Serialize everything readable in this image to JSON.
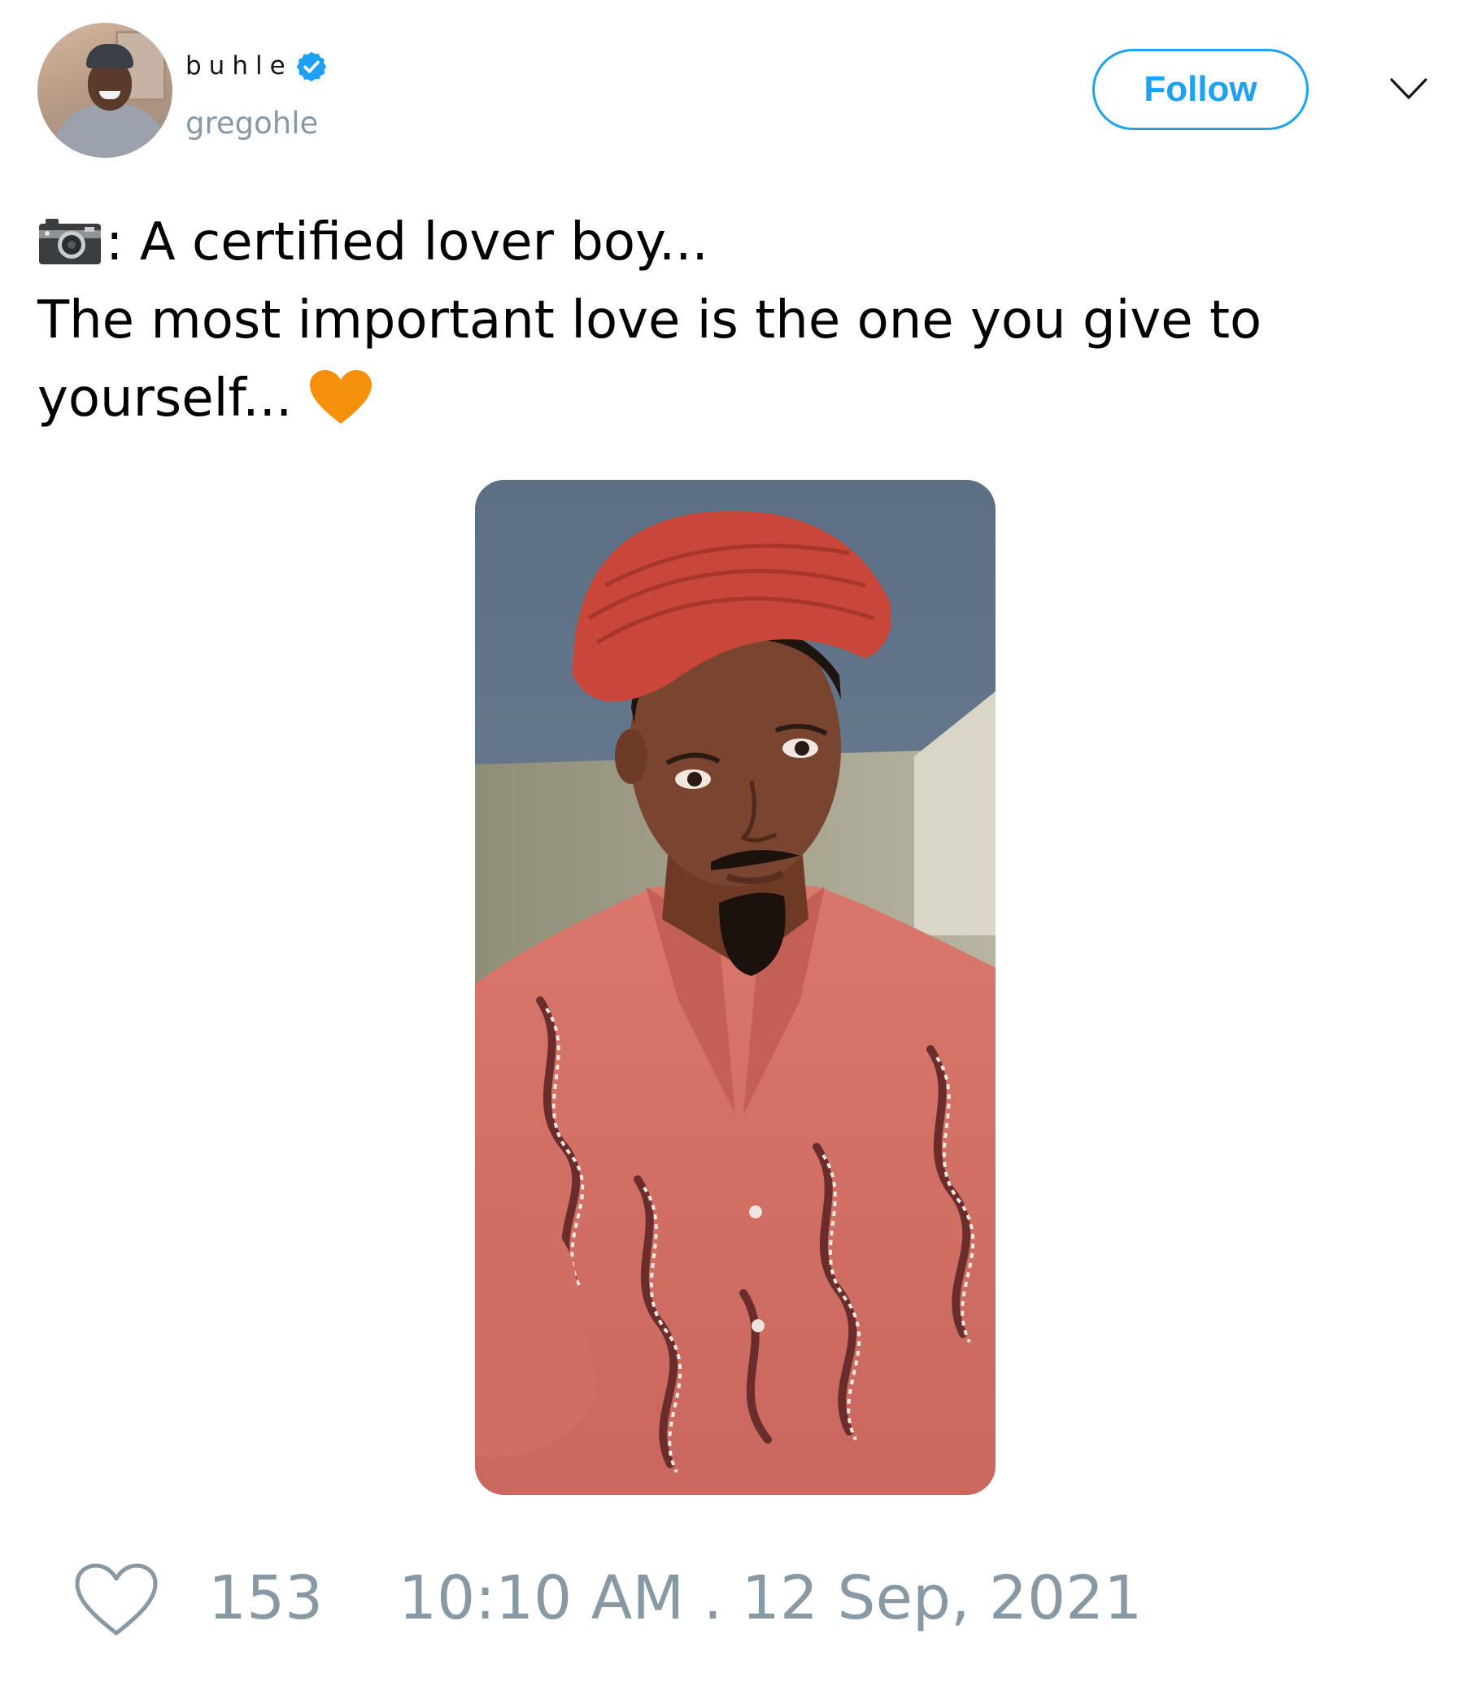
{
  "author": {
    "display_name": "buhle",
    "handle": "gregohle",
    "verified": true,
    "avatar_icon": "profile-photo"
  },
  "actions": {
    "follow_label": "Follow",
    "menu_icon": "chevron-down-icon"
  },
  "tweet": {
    "line1": ": A certified lover boy...",
    "line2": "The most important love is the one you give to",
    "line3": "yourself...",
    "emoji_start": "camera",
    "emoji_end": "orange-heart"
  },
  "media": {
    "type": "photo"
  },
  "footer": {
    "like_count": "153",
    "timestamp": "10:10 AM . 12 Sep, 2021"
  },
  "colors": {
    "accent": "#1da1f2",
    "muted": "#8899a6",
    "heart": "#f4900c"
  }
}
